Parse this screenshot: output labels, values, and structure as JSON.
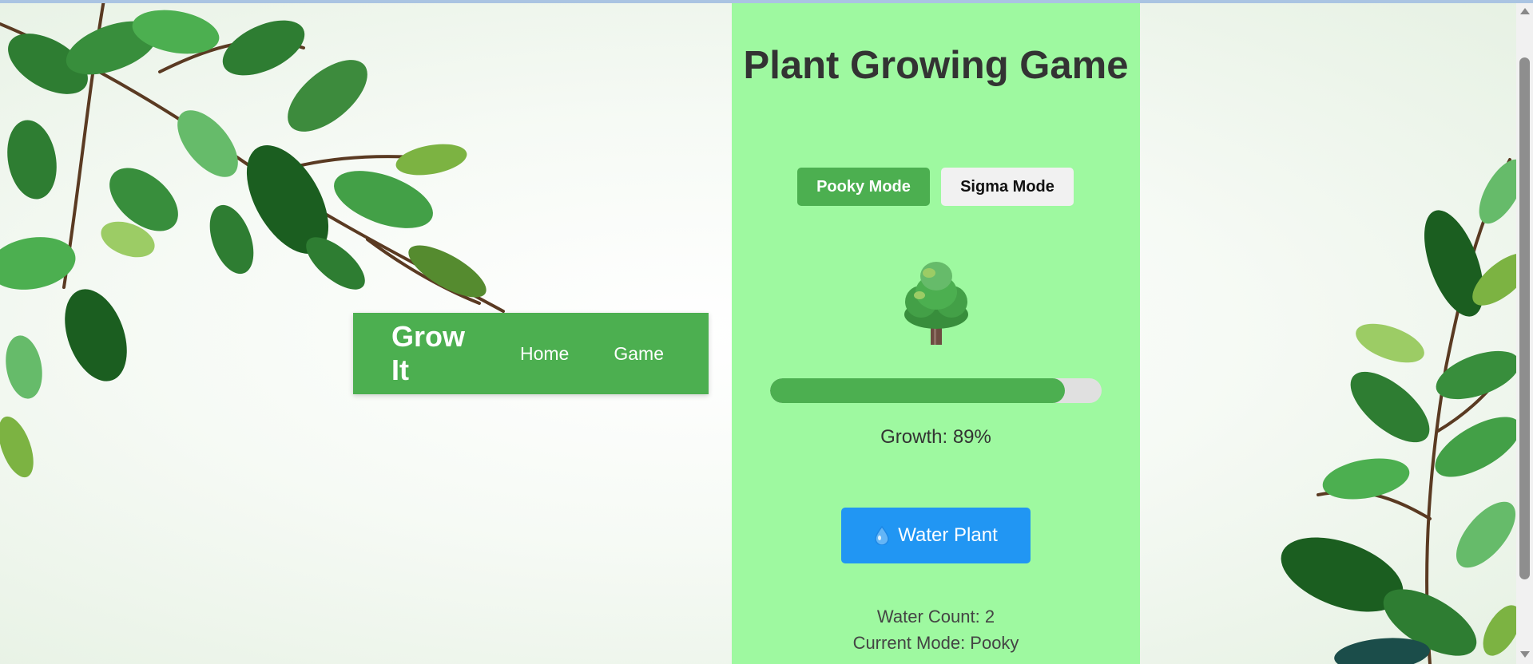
{
  "nav": {
    "brand": "Grow It",
    "links": [
      "Home",
      "Game"
    ]
  },
  "game": {
    "title": "Plant Growing Game",
    "modes": [
      "Pooky Mode",
      "Sigma Mode"
    ],
    "active_mode_index": 0,
    "plant_icon": "deciduous-tree-icon",
    "growth_percent": 89,
    "growth_text": "Growth: 89%",
    "water_button_icon": "water-drop-icon",
    "water_button_label": "Water Plant",
    "water_count_text": "Water Count: 2",
    "current_mode_text": "Current Mode: Pooky"
  },
  "colors": {
    "accent_green": "#4caf50",
    "panel_green": "#9ef9a0",
    "water_blue": "#2196f3"
  }
}
